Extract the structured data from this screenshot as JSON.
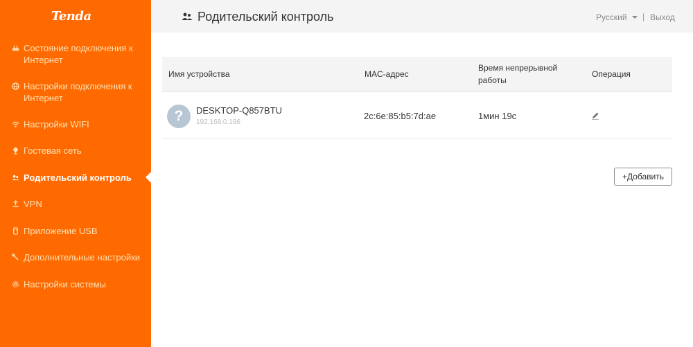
{
  "brand": {
    "logo_text": "Tenda",
    "accent_color": "#ff6a00"
  },
  "sidebar": {
    "items": [
      {
        "label": "Состояние подключения к Интернет",
        "icon": "router-status-icon",
        "active": false
      },
      {
        "label": "Настройки подключения к Интернет",
        "icon": "globe-icon",
        "active": false
      },
      {
        "label": "Настройки WIFI",
        "icon": "wifi-icon",
        "active": false
      },
      {
        "label": "Гостевая сеть",
        "icon": "guest-network-icon",
        "active": false
      },
      {
        "label": "Родительский контроль",
        "icon": "parental-control-icon",
        "active": true
      },
      {
        "label": "VPN",
        "icon": "vpn-icon",
        "active": false
      },
      {
        "label": "Приложение USB",
        "icon": "usb-icon",
        "active": false
      },
      {
        "label": "Дополнительные настройки",
        "icon": "tools-icon",
        "active": false
      },
      {
        "label": "Настройки системы",
        "icon": "gear-icon",
        "active": false
      }
    ]
  },
  "header": {
    "title": "Родительский контроль",
    "title_icon": "parental-control-icon",
    "language": "Русский",
    "separator": "|",
    "logout": "Выход"
  },
  "table": {
    "columns": [
      "Имя устройства",
      "MAC-адрес",
      "Время непрерывной работы",
      "Операция"
    ],
    "rows": [
      {
        "avatar_symbol": "?",
        "device_name": "DESKTOP-Q857BTU",
        "ip": "192.168.0.196",
        "mac": "2c:6e:85:b5:7d:ae",
        "uptime": "1мин 19с",
        "operation_icon": "edit-pencil-icon"
      }
    ]
  },
  "add_button": {
    "label": "+Добавить"
  }
}
